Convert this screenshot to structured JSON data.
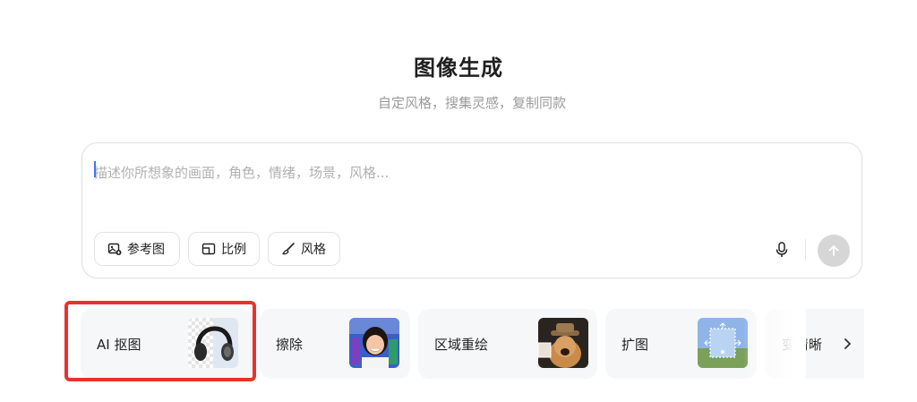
{
  "header": {
    "title": "图像生成",
    "subtitle": "自定风格，搜集灵感，复制同款"
  },
  "prompt": {
    "placeholder": "描述你所想象的画面，角色，情绪，场景，风格...",
    "value": ""
  },
  "toolbar": {
    "reference_label": "参考图",
    "ratio_label": "比例",
    "style_label": "风格"
  },
  "tools": [
    {
      "label": "AI 抠图",
      "icon": "headphones-cutout-thumbnail"
    },
    {
      "label": "擦除",
      "icon": "girl-portrait-thumbnail"
    },
    {
      "label": "区域重绘",
      "icon": "dog-hat-thumbnail"
    },
    {
      "label": "扩图",
      "icon": "landscape-expand-thumbnail"
    },
    {
      "label": "变清晰",
      "icon": ""
    }
  ],
  "colors": {
    "highlight": "#e8322f",
    "send_disabled": "#d6d6d6",
    "caret": "#4a6cf7"
  }
}
